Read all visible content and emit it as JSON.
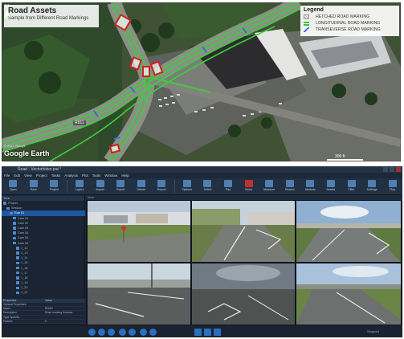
{
  "map": {
    "title": "Road Assets",
    "subtitle": "Sample from Different Road Markings",
    "legend_title": "Legend",
    "legend_items": [
      {
        "label": "HETCHED ROAD MARKING",
        "color": "#d9d9d9"
      },
      {
        "label": "LONGITUDINAL ROAD MARKING",
        "color": "#39c539"
      },
      {
        "label": "TRANSEVERSE ROAD MARKING",
        "color": "#3b6bd6"
      }
    ],
    "google_earth": "Google Earth",
    "copyright": "© 2017 Google",
    "scale_label": "300 ft",
    "road_label": "R811"
  },
  "app": {
    "window_title": "Road - Vectorhistor.pat *",
    "menu": [
      "File",
      "Edit",
      "View",
      "Project",
      "Tasks",
      "Analysis",
      "Plot",
      "Tools",
      "Window",
      "Help"
    ],
    "toolbar": [
      "Open",
      "Save",
      "Project",
      "Layers",
      "Import",
      "Export",
      "Viewer",
      "Report",
      "Options",
      "Select",
      "Pan",
      "Zoom",
      "Measure",
      "Record",
      "Markers",
      "Assets",
      "Filter",
      "Settings",
      "Play"
    ],
    "tree_header": "Tree",
    "tree_items": [
      "Project",
      "Session",
      "Run 01",
      "Cam 01",
      "Cam 02",
      "Cam 03",
      "Cam 04",
      "Cam 05",
      "Cam 06",
      "1_12",
      "1_13",
      "1_14",
      "1_15",
      "1_16",
      "1_17",
      "1_18",
      "1_19",
      "1_20",
      "1_21"
    ],
    "props_header": [
      "Properties",
      "Value"
    ],
    "props": [
      [
        "General Properties",
        ""
      ],
      [
        "Name",
        "ROAD"
      ],
      [
        "Description",
        "Road marking features"
      ],
      [
        "Type Specific",
        ""
      ],
      [
        "Frames",
        "6"
      ]
    ],
    "viewer_title": "View",
    "status": "Stopped"
  }
}
